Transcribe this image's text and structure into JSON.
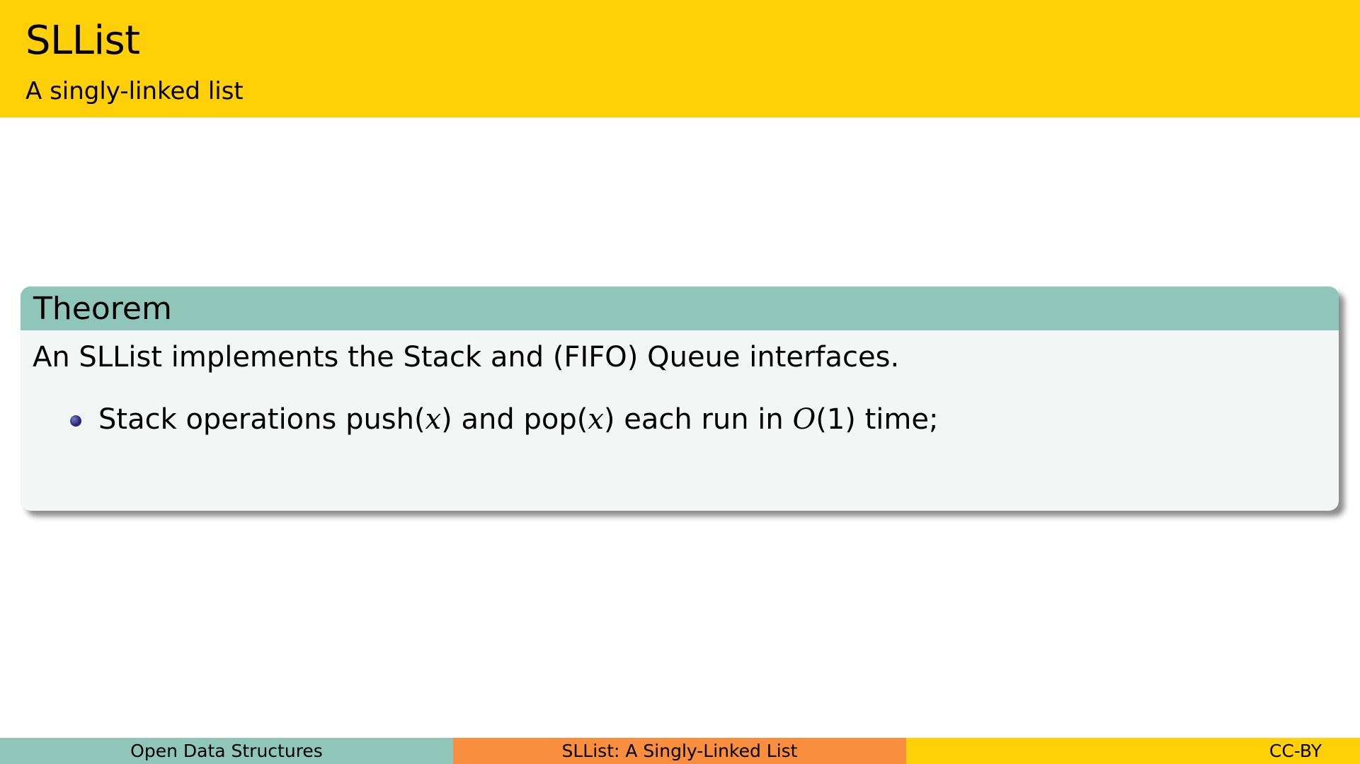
{
  "slide": {
    "title": "SLList",
    "subtitle": "A singly-linked list"
  },
  "theorem": {
    "heading": "Theorem",
    "statement": "An SLList implements the Stack and (FIFO) Queue interfaces.",
    "bullets": [
      {
        "prefix": "Stack operations push(",
        "var1": "x",
        "mid1": ") and pop(",
        "var2": "x",
        "mid2": ") each run in ",
        "bigO": "O",
        "suffix": "(1) time;"
      }
    ]
  },
  "footer": {
    "left": "Open Data Structures",
    "center": "SLList: A Singly-Linked List",
    "right": "CC-BY"
  },
  "colors": {
    "header": "#FFCF07",
    "theorem_header": "#8FC6B9",
    "theorem_body": "#F2F7F6",
    "footer_left": "#8FC6B9",
    "footer_center": "#F98E3E",
    "footer_right": "#FFCF07",
    "bullet": "#2a2a7a"
  }
}
